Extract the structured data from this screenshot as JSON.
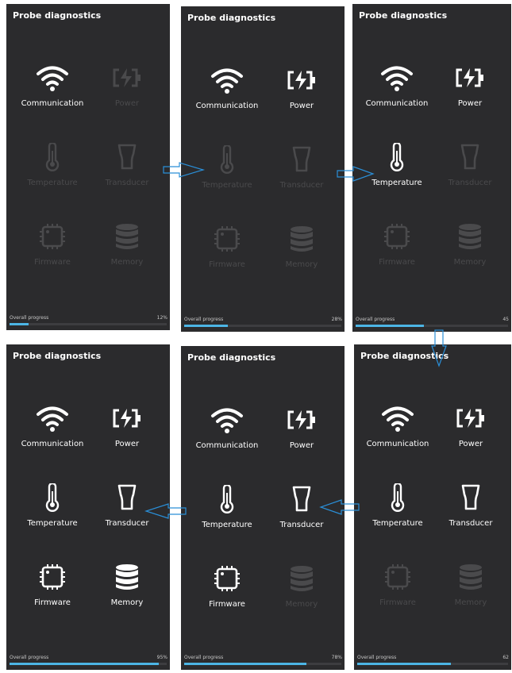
{
  "panels": [
    {
      "title": "Probe diagnostics",
      "progress_label": "Overall progress",
      "progress_value": "12%",
      "progress": 0.12,
      "items": [
        {
          "label": "Communication",
          "icon": "wifi-icon",
          "active": true
        },
        {
          "label": "Power",
          "icon": "battery-icon",
          "active": false
        },
        {
          "label": "Temperature",
          "icon": "thermometer-icon",
          "active": false
        },
        {
          "label": "Transducer",
          "icon": "probe-icon",
          "active": false
        },
        {
          "label": "Firmware",
          "icon": "chip-icon",
          "active": false
        },
        {
          "label": "Memory",
          "icon": "database-icon",
          "active": false
        }
      ]
    },
    {
      "title": "Probe diagnostics",
      "progress_label": "Overall progress",
      "progress_value": "28%",
      "progress": 0.28,
      "items": [
        {
          "label": "Communication",
          "icon": "wifi-icon",
          "active": true
        },
        {
          "label": "Power",
          "icon": "battery-icon",
          "active": true
        },
        {
          "label": "Temperature",
          "icon": "thermometer-icon",
          "active": false
        },
        {
          "label": "Transducer",
          "icon": "probe-icon",
          "active": false
        },
        {
          "label": "Firmware",
          "icon": "chip-icon",
          "active": false
        },
        {
          "label": "Memory",
          "icon": "database-icon",
          "active": false
        }
      ]
    },
    {
      "title": "Probe diagnostics",
      "progress_label": "Overall progress",
      "progress_value": "45",
      "progress": 0.45,
      "items": [
        {
          "label": "Communication",
          "icon": "wifi-icon",
          "active": true
        },
        {
          "label": "Power",
          "icon": "battery-icon",
          "active": true
        },
        {
          "label": "Temperature",
          "icon": "thermometer-icon",
          "active": true
        },
        {
          "label": "Transducer",
          "icon": "probe-icon",
          "active": false
        },
        {
          "label": "Firmware",
          "icon": "chip-icon",
          "active": false
        },
        {
          "label": "Memory",
          "icon": "database-icon",
          "active": false
        }
      ]
    },
    {
      "title": "Probe diagnostics",
      "progress_label": "Overall progress",
      "progress_value": "95%",
      "progress": 0.95,
      "items": [
        {
          "label": "Communication",
          "icon": "wifi-icon",
          "active": true
        },
        {
          "label": "Power",
          "icon": "battery-icon",
          "active": true
        },
        {
          "label": "Temperature",
          "icon": "thermometer-icon",
          "active": true
        },
        {
          "label": "Transducer",
          "icon": "probe-icon",
          "active": true
        },
        {
          "label": "Firmware",
          "icon": "chip-icon",
          "active": true
        },
        {
          "label": "Memory",
          "icon": "database-icon",
          "active": true
        }
      ]
    },
    {
      "title": "Probe diagnostics",
      "progress_label": "Overall progress",
      "progress_value": "78%",
      "progress": 0.78,
      "items": [
        {
          "label": "Communication",
          "icon": "wifi-icon",
          "active": true
        },
        {
          "label": "Power",
          "icon": "battery-icon",
          "active": true
        },
        {
          "label": "Temperature",
          "icon": "thermometer-icon",
          "active": true
        },
        {
          "label": "Transducer",
          "icon": "probe-icon",
          "active": true
        },
        {
          "label": "Firmware",
          "icon": "chip-icon",
          "active": true
        },
        {
          "label": "Memory",
          "icon": "database-icon",
          "active": false
        }
      ]
    },
    {
      "title": "Probe diagnostics",
      "progress_label": "Overall progress",
      "progress_value": "62",
      "progress": 0.62,
      "items": [
        {
          "label": "Communication",
          "icon": "wifi-icon",
          "active": true
        },
        {
          "label": "Power",
          "icon": "battery-icon",
          "active": true
        },
        {
          "label": "Temperature",
          "icon": "thermometer-icon",
          "active": true
        },
        {
          "label": "Transducer",
          "icon": "probe-icon",
          "active": true
        },
        {
          "label": "Firmware",
          "icon": "chip-icon",
          "active": false
        },
        {
          "label": "Memory",
          "icon": "database-icon",
          "active": false
        }
      ]
    }
  ],
  "colors": {
    "panel_bg": "#2b2b2d",
    "active": "#ffffff",
    "inactive": "#4a4a4c",
    "progress_fill": "#4cb5e5",
    "arrow": "#2a8fd8"
  }
}
